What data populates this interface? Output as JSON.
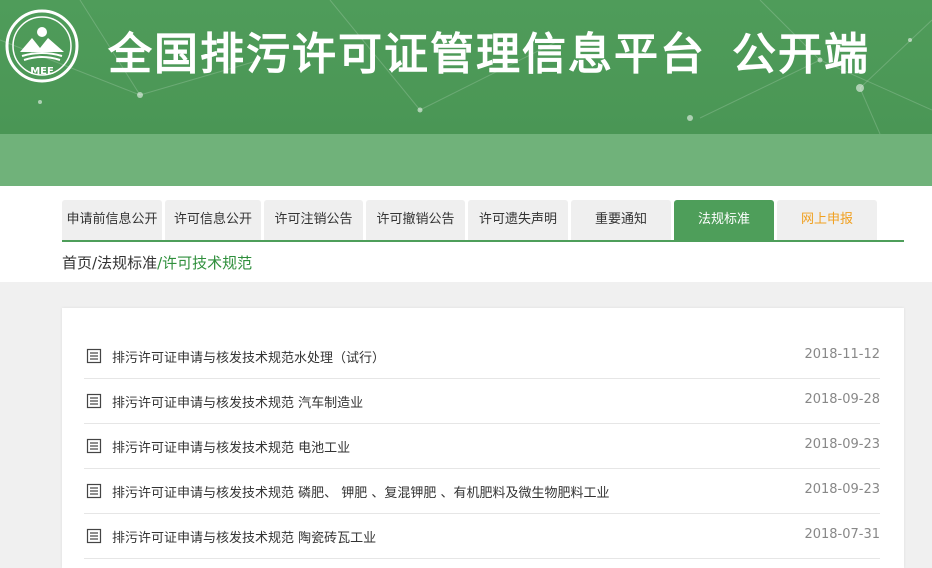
{
  "header": {
    "logo_text": "MEE",
    "title": "全国排污许可证管理信息平台",
    "title_suffix": "公开端",
    "colors": {
      "banner": "#4f9c5a",
      "banner_sub": "#70b27a"
    }
  },
  "nav": {
    "tabs": [
      {
        "label": "申请前信息公开",
        "active": false
      },
      {
        "label": "许可信息公开",
        "active": false
      },
      {
        "label": "许可注销公告",
        "active": false
      },
      {
        "label": "许可撤销公告",
        "active": false
      },
      {
        "label": "许可遗失声明",
        "active": false
      },
      {
        "label": "重要通知",
        "active": false
      },
      {
        "label": "法规标准",
        "active": true
      },
      {
        "label": "网上申报",
        "active": false
      }
    ],
    "colors": {
      "active": "#4e9e5a",
      "report": "#f0a020"
    }
  },
  "breadcrumb": {
    "home": "首页/",
    "section": "法规标准",
    "current": "/许可技术规范"
  },
  "documents": [
    {
      "title": "排污许可证申请与核发技术规范水处理（试行）",
      "date": "2018-11-12"
    },
    {
      "title": "排污许可证申请与核发技术规范 汽车制造业",
      "date": "2018-09-28"
    },
    {
      "title": "排污许可证申请与核发技术规范 电池工业",
      "date": "2018-09-23"
    },
    {
      "title": "排污许可证申请与核发技术规范 磷肥、 钾肥 、复混钾肥 、有机肥料及微生物肥料工业",
      "date": "2018-09-23"
    },
    {
      "title": "排污许可证申请与核发技术规范 陶瓷砖瓦工业",
      "date": "2018-07-31"
    }
  ]
}
